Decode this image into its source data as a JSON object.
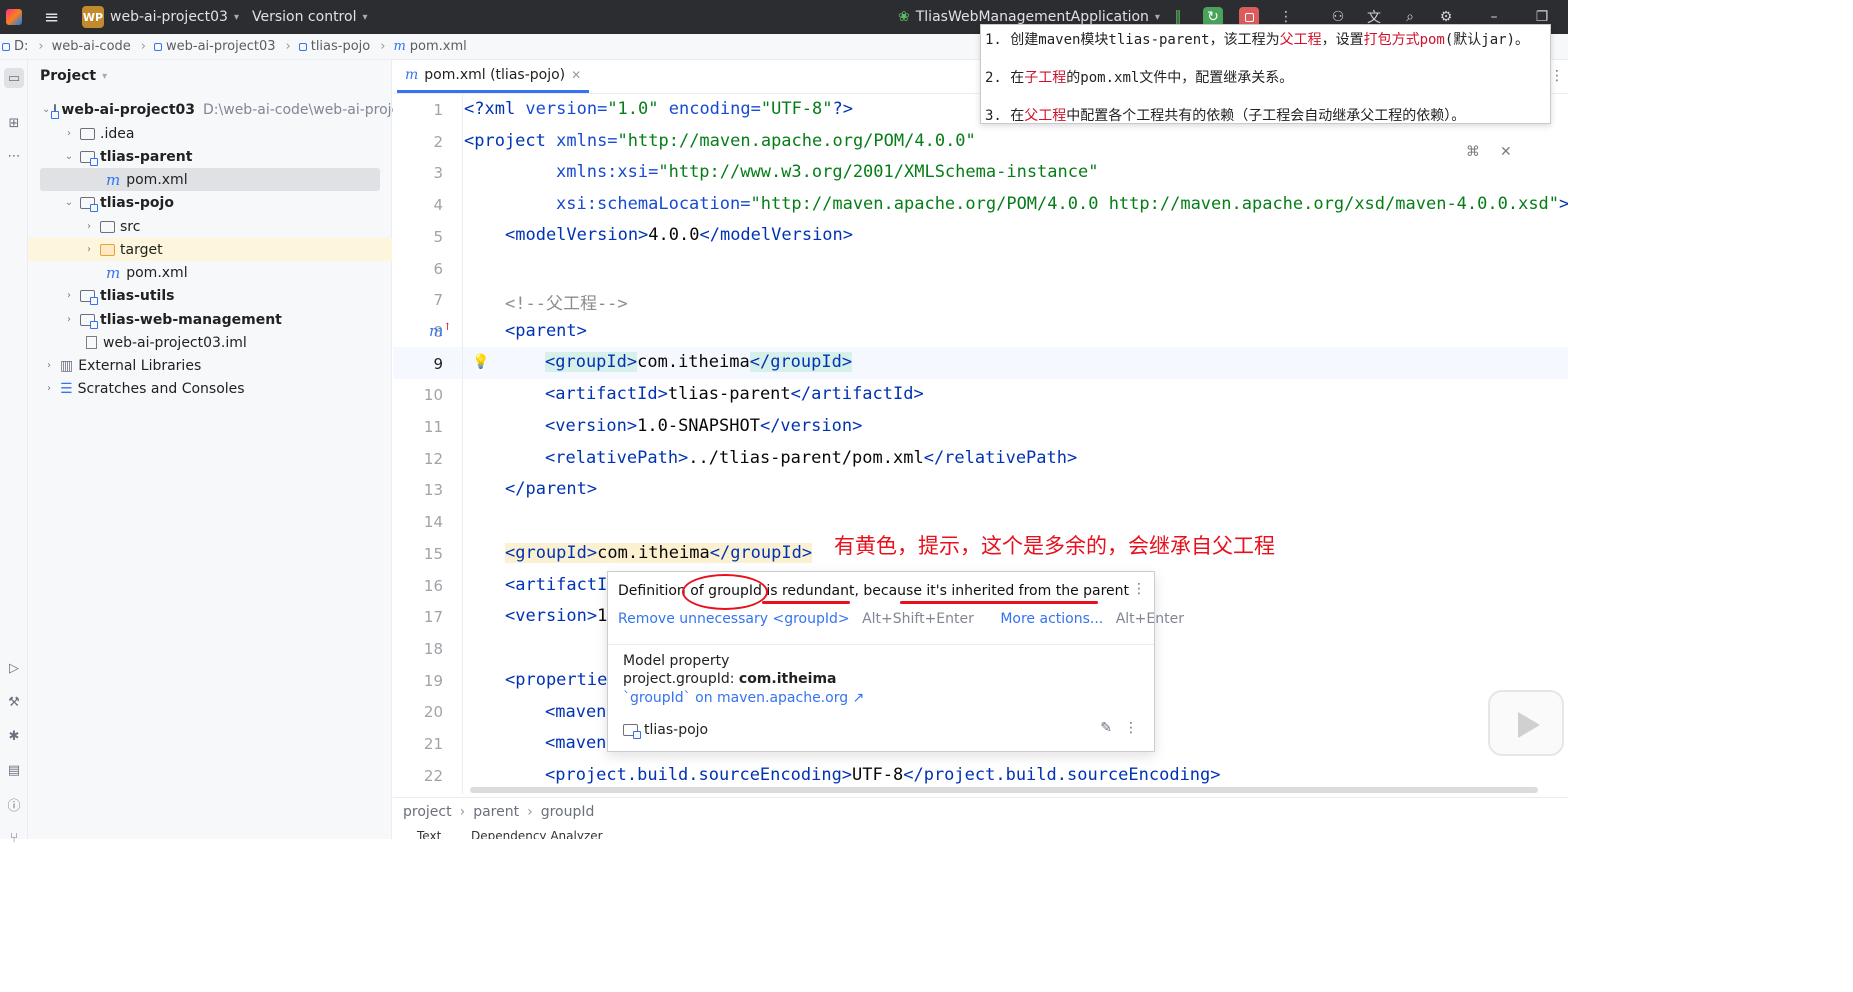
{
  "titlebar": {
    "logo": "jetbrains-logo",
    "project_badge": "WP",
    "project_name": "web-ai-project03",
    "vcs": "Version control",
    "run_config": "TliasWebManagementApplication"
  },
  "breadcrumb": [
    "D:",
    "web-ai-code",
    "web-ai-project03",
    "tlias-pojo",
    "pom.xml"
  ],
  "project_panel": {
    "title": "Project",
    "root": {
      "name": "web-ai-project03",
      "path": "D:\\web-ai-code\\web-ai-proje"
    },
    "items": [
      {
        "label": ".idea"
      },
      {
        "label": "tlias-parent"
      },
      {
        "label": "pom.xml"
      },
      {
        "label": "tlias-pojo"
      },
      {
        "label": "src"
      },
      {
        "label": "target"
      },
      {
        "label": "pom.xml"
      },
      {
        "label": "tlias-utils"
      },
      {
        "label": "tlias-web-management"
      },
      {
        "label": "web-ai-project03.iml"
      },
      {
        "label": "External Libraries"
      },
      {
        "label": "Scratches and Consoles"
      }
    ]
  },
  "tab": {
    "label": "pom.xml (tlias-pojo)"
  },
  "editor": {
    "line_numbers": [
      "1",
      "2",
      "3",
      "4",
      "5",
      "6",
      "7",
      "8",
      "9",
      "10",
      "11",
      "12",
      "13",
      "14",
      "15",
      "16",
      "17",
      "18",
      "19",
      "20",
      "21",
      "22"
    ],
    "lines": {
      "l1a": "<?xml ",
      "l1b": "version=",
      "l1c": "\"1.0\"",
      "l1d": " encoding=",
      "l1e": "\"UTF-8\"",
      "l1f": "?>",
      "l2a": "<project ",
      "l2b": "xmlns=",
      "l2c": "\"http://maven.apache.org/POM/4.0.0\"",
      "l3b": "xmlns:xsi=",
      "l3c": "\"http://www.w3.org/2001/XMLSchema-instance\"",
      "l4b": "xsi:schemaLocation=",
      "l4c": "\"http://maven.apache.org/POM/4.0.0 http://maven.apache.org/xsd/maven-4.0.0.xsd\"",
      "l4d": ">",
      "l5a": "<modelVersion>",
      "l5b": "4.0.0",
      "l5c": "</modelVersion>",
      "l7": "<!--父工程-->",
      "l8": "<parent>",
      "l9a": "<groupId>",
      "l9b": "com.itheima",
      "l9c": "</groupId>",
      "l10a": "<artifactId>",
      "l10b": "tlias-parent",
      "l10c": "</artifactId>",
      "l11a": "<version>",
      "l11b": "1.0-SNAPSHOT",
      "l11c": "</version>",
      "l12a": "<relativePath>",
      "l12b": "../tlias-parent/pom.xml",
      "l12c": "</relativePath>",
      "l13": "</parent>",
      "l15a": "<groupId>",
      "l15b": "com.itheima",
      "l15c": "</groupId>",
      "l16": "<artifactI",
      "l17a": "<version>",
      "l17b": "1",
      "l19": "<propertie",
      "l20": "<maven",
      "l21": "<maven",
      "l22a": "<project.build.sourceEncoding>",
      "l22b": "UTF-8",
      "l22c": "</project.build.sourceEncoding>"
    }
  },
  "notes": [
    {
      "a": "1. 创建maven模块tlias-parent，该工程为",
      "b": "父工程",
      "c": "，设置",
      "d": "打包方式pom",
      "e": "(默认jar)。"
    },
    {
      "a": "2. 在",
      "b": "子工程",
      "c": "的pom.xml文件中，配置继承关系。"
    },
    {
      "a": "3. 在",
      "b": "父工程",
      "c": "中配置各个工程共有的依赖（子工程会自动继承父工程的依赖）。"
    }
  ],
  "annotation": "有黄色，提示，这个是多余的，会继承自父工程",
  "popup": {
    "message": "Definition of groupId is redundant, because it's inherited from the parent",
    "action": "Remove unnecessary <groupId>",
    "action_shortcut": "Alt+Shift+Enter",
    "more": "More actions...",
    "more_shortcut": "Alt+Enter",
    "info_title": "Model property",
    "info_key": "project.groupId: ",
    "info_value": "com.itheima",
    "info_link": "`groupId` on maven.apache.org ↗",
    "module": "tlias-pojo"
  },
  "status_breadcrumb": [
    "project",
    "parent",
    "groupId"
  ],
  "bottom_tabs": [
    "Text",
    "Dependency Analyzer"
  ],
  "colors": {
    "accent": "#3574f0",
    "annotation_red": "#e8101c",
    "tag": "#0033b3",
    "string": "#067d17"
  }
}
